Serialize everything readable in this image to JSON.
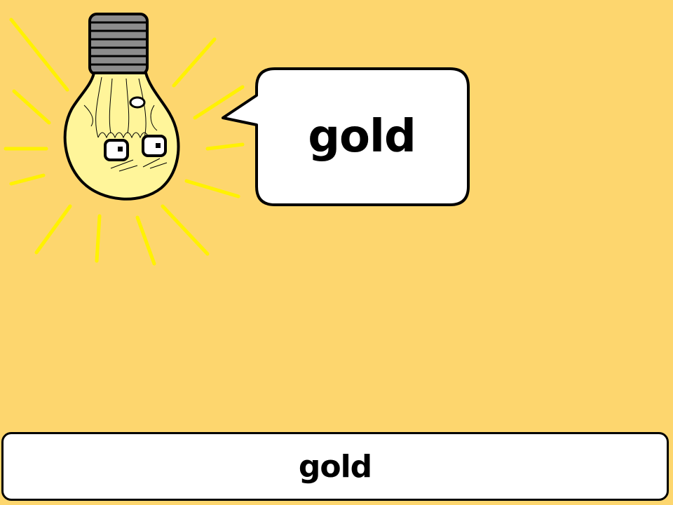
{
  "speech": {
    "text": "gold"
  },
  "caption": {
    "text": "gold"
  },
  "colors": {
    "background": "#FDD66E",
    "bulb_glass": "#FFF59A",
    "rays": "#FFF200",
    "screw_base": "#8C8C8C"
  },
  "icons": {
    "character": "light-bulb-icon"
  }
}
